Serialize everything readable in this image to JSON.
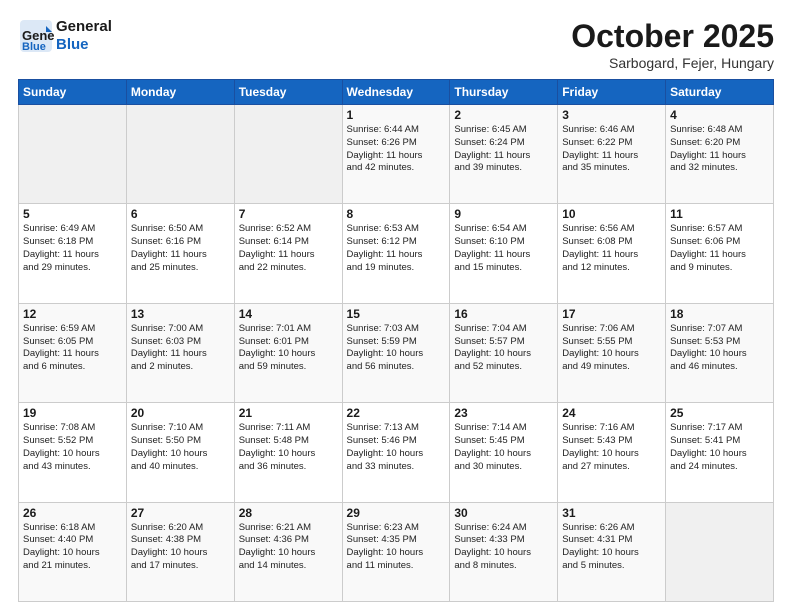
{
  "logo": {
    "line1": "General",
    "line2": "Blue"
  },
  "title": "October 2025",
  "location": "Sarbogard, Fejer, Hungary",
  "weekdays": [
    "Sunday",
    "Monday",
    "Tuesday",
    "Wednesday",
    "Thursday",
    "Friday",
    "Saturday"
  ],
  "weeks": [
    [
      {
        "day": "",
        "info": ""
      },
      {
        "day": "",
        "info": ""
      },
      {
        "day": "",
        "info": ""
      },
      {
        "day": "1",
        "info": "Sunrise: 6:44 AM\nSunset: 6:26 PM\nDaylight: 11 hours\nand 42 minutes."
      },
      {
        "day": "2",
        "info": "Sunrise: 6:45 AM\nSunset: 6:24 PM\nDaylight: 11 hours\nand 39 minutes."
      },
      {
        "day": "3",
        "info": "Sunrise: 6:46 AM\nSunset: 6:22 PM\nDaylight: 11 hours\nand 35 minutes."
      },
      {
        "day": "4",
        "info": "Sunrise: 6:48 AM\nSunset: 6:20 PM\nDaylight: 11 hours\nand 32 minutes."
      }
    ],
    [
      {
        "day": "5",
        "info": "Sunrise: 6:49 AM\nSunset: 6:18 PM\nDaylight: 11 hours\nand 29 minutes."
      },
      {
        "day": "6",
        "info": "Sunrise: 6:50 AM\nSunset: 6:16 PM\nDaylight: 11 hours\nand 25 minutes."
      },
      {
        "day": "7",
        "info": "Sunrise: 6:52 AM\nSunset: 6:14 PM\nDaylight: 11 hours\nand 22 minutes."
      },
      {
        "day": "8",
        "info": "Sunrise: 6:53 AM\nSunset: 6:12 PM\nDaylight: 11 hours\nand 19 minutes."
      },
      {
        "day": "9",
        "info": "Sunrise: 6:54 AM\nSunset: 6:10 PM\nDaylight: 11 hours\nand 15 minutes."
      },
      {
        "day": "10",
        "info": "Sunrise: 6:56 AM\nSunset: 6:08 PM\nDaylight: 11 hours\nand 12 minutes."
      },
      {
        "day": "11",
        "info": "Sunrise: 6:57 AM\nSunset: 6:06 PM\nDaylight: 11 hours\nand 9 minutes."
      }
    ],
    [
      {
        "day": "12",
        "info": "Sunrise: 6:59 AM\nSunset: 6:05 PM\nDaylight: 11 hours\nand 6 minutes."
      },
      {
        "day": "13",
        "info": "Sunrise: 7:00 AM\nSunset: 6:03 PM\nDaylight: 11 hours\nand 2 minutes."
      },
      {
        "day": "14",
        "info": "Sunrise: 7:01 AM\nSunset: 6:01 PM\nDaylight: 10 hours\nand 59 minutes."
      },
      {
        "day": "15",
        "info": "Sunrise: 7:03 AM\nSunset: 5:59 PM\nDaylight: 10 hours\nand 56 minutes."
      },
      {
        "day": "16",
        "info": "Sunrise: 7:04 AM\nSunset: 5:57 PM\nDaylight: 10 hours\nand 52 minutes."
      },
      {
        "day": "17",
        "info": "Sunrise: 7:06 AM\nSunset: 5:55 PM\nDaylight: 10 hours\nand 49 minutes."
      },
      {
        "day": "18",
        "info": "Sunrise: 7:07 AM\nSunset: 5:53 PM\nDaylight: 10 hours\nand 46 minutes."
      }
    ],
    [
      {
        "day": "19",
        "info": "Sunrise: 7:08 AM\nSunset: 5:52 PM\nDaylight: 10 hours\nand 43 minutes."
      },
      {
        "day": "20",
        "info": "Sunrise: 7:10 AM\nSunset: 5:50 PM\nDaylight: 10 hours\nand 40 minutes."
      },
      {
        "day": "21",
        "info": "Sunrise: 7:11 AM\nSunset: 5:48 PM\nDaylight: 10 hours\nand 36 minutes."
      },
      {
        "day": "22",
        "info": "Sunrise: 7:13 AM\nSunset: 5:46 PM\nDaylight: 10 hours\nand 33 minutes."
      },
      {
        "day": "23",
        "info": "Sunrise: 7:14 AM\nSunset: 5:45 PM\nDaylight: 10 hours\nand 30 minutes."
      },
      {
        "day": "24",
        "info": "Sunrise: 7:16 AM\nSunset: 5:43 PM\nDaylight: 10 hours\nand 27 minutes."
      },
      {
        "day": "25",
        "info": "Sunrise: 7:17 AM\nSunset: 5:41 PM\nDaylight: 10 hours\nand 24 minutes."
      }
    ],
    [
      {
        "day": "26",
        "info": "Sunrise: 6:18 AM\nSunset: 4:40 PM\nDaylight: 10 hours\nand 21 minutes."
      },
      {
        "day": "27",
        "info": "Sunrise: 6:20 AM\nSunset: 4:38 PM\nDaylight: 10 hours\nand 17 minutes."
      },
      {
        "day": "28",
        "info": "Sunrise: 6:21 AM\nSunset: 4:36 PM\nDaylight: 10 hours\nand 14 minutes."
      },
      {
        "day": "29",
        "info": "Sunrise: 6:23 AM\nSunset: 4:35 PM\nDaylight: 10 hours\nand 11 minutes."
      },
      {
        "day": "30",
        "info": "Sunrise: 6:24 AM\nSunset: 4:33 PM\nDaylight: 10 hours\nand 8 minutes."
      },
      {
        "day": "31",
        "info": "Sunrise: 6:26 AM\nSunset: 4:31 PM\nDaylight: 10 hours\nand 5 minutes."
      },
      {
        "day": "",
        "info": ""
      }
    ]
  ]
}
